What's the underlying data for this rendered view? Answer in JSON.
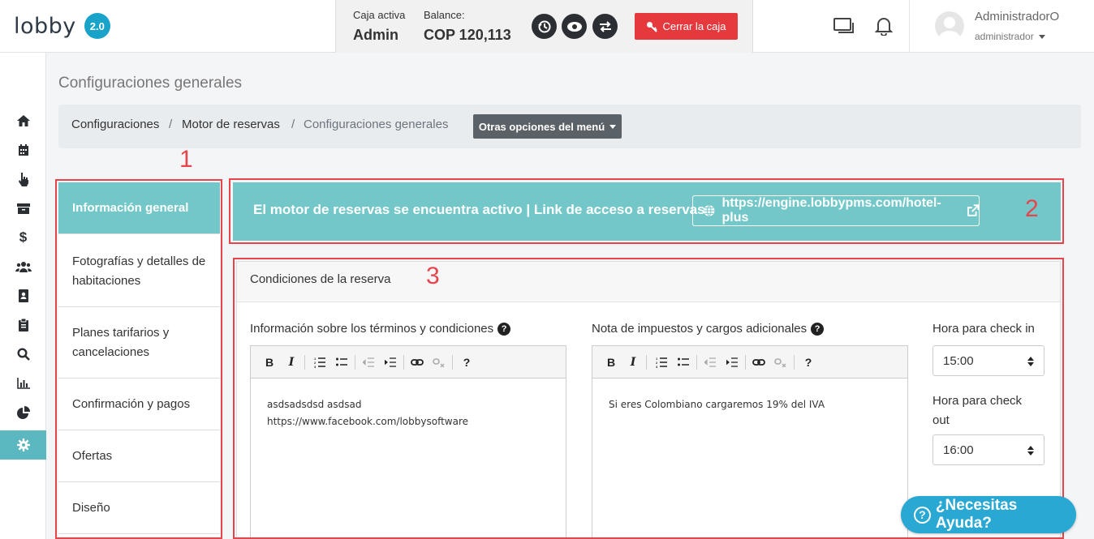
{
  "header": {
    "logo_text": "lobby",
    "version_badge": "2.0",
    "cashbox": {
      "active_label": "Caja activa",
      "active_value": "Admin",
      "balance_label": "Balance:",
      "balance_value": "COP 120,113",
      "close_button": "Cerrar la caja"
    },
    "user": {
      "name": "AdministradorO",
      "role": "administrador"
    }
  },
  "sidebar_icons": [
    "home-icon",
    "calendar-icon",
    "hand-pointer-icon",
    "archive-icon",
    "dollar-icon",
    "users-icon",
    "contact-book-icon",
    "clipboard-icon",
    "search-icon",
    "bar-chart-icon",
    "pie-chart-icon",
    "gear-icon"
  ],
  "page": {
    "title": "Configuraciones generales",
    "breadcrumb": [
      "Configuraciones",
      "Motor de reservas",
      "Configuraciones generales"
    ],
    "menu_button": "Otras opciones del menú"
  },
  "settings_nav": {
    "items": [
      {
        "label": "Información general",
        "active": true
      },
      {
        "label": "Fotografías y detalles de habitaciones",
        "active": false
      },
      {
        "label": "Planes tarifarios y cancelaciones",
        "active": false
      },
      {
        "label": "Confirmación y pagos",
        "active": false
      },
      {
        "label": "Ofertas",
        "active": false
      },
      {
        "label": "Diseño",
        "active": false
      }
    ]
  },
  "annotations": {
    "one": "1",
    "two": "2",
    "three": "3"
  },
  "banner": {
    "text": "El motor de reservas se encuentra activo | Link de acceso a reservas:",
    "link": "https://engine.lobbypms.com/hotel-plus"
  },
  "conditions": {
    "title": "Condiciones de la reserva",
    "terms_label": "Información sobre los términos y condiciones",
    "terms_lines": [
      "asdsadsdsd asdsad",
      "https://www.facebook.com/lobbysoftware"
    ],
    "taxes_label": "Nota de impuestos y cargos adicionales",
    "taxes_lines": [
      "Si eres Colombiano cargaremos 19% del IVA"
    ],
    "checkin_label": "Hora para check in",
    "checkin_value": "15:00",
    "checkout_label_1": "Hora para check",
    "checkout_label_2": "out",
    "checkout_value": "16:00"
  },
  "toolbar": {
    "bold": "B",
    "italic": "I",
    "help": "?"
  },
  "help_button": "¿Necesitas Ayuda?",
  "colors": {
    "teal": "#73c7c8",
    "red": "#e5393e",
    "help_blue": "#29a8d3"
  }
}
